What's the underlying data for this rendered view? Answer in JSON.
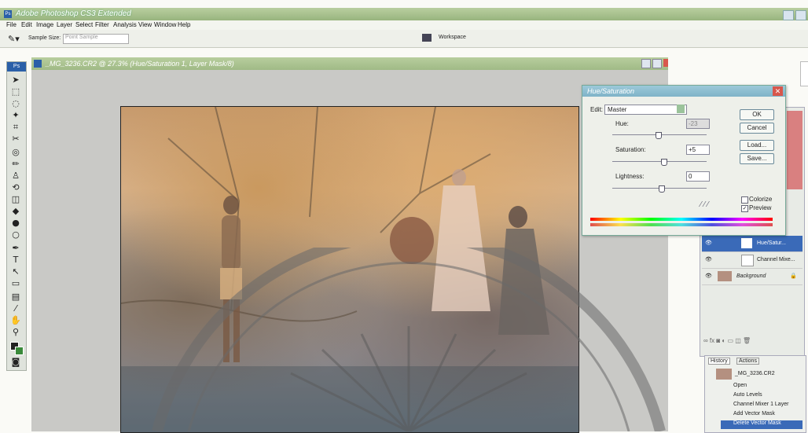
{
  "app": {
    "title": "Adobe Photoshop CS3 Extended",
    "logo": "Ps",
    "window_buttons": [
      "minimize",
      "close"
    ]
  },
  "menu": [
    "File",
    "Edit",
    "Image",
    "Layer",
    "Select",
    "Filter",
    "Analysis",
    "View",
    "Window",
    "Help"
  ],
  "options_bar": {
    "sample_size_label": "Sample Size:",
    "sample_size_value": "Point Sample",
    "workspace_label": "Workspace"
  },
  "document": {
    "title": "_MG_3236.CR2 @ 27.3% (Hue/Saturation 1, Layer Mask/8)"
  },
  "dialog": {
    "title": "Hue/Saturation",
    "edit_label": "Edit:",
    "edit_value": "Master",
    "hue_label": "Hue:",
    "hue_value": "-23",
    "saturation_label": "Saturation:",
    "saturation_value": "+5",
    "lightness_label": "Lightness:",
    "lightness_value": "0",
    "ok": "OK",
    "cancel": "Cancel",
    "load": "Load...",
    "save": "Save...",
    "colorize": "Colorize",
    "preview": "Preview",
    "preview_checked": true
  },
  "layers": [
    {
      "name": "Hue/Satur..."
    },
    {
      "name": "Channel Mixe..."
    },
    {
      "name": "Background"
    }
  ],
  "history": {
    "tabs": [
      "History",
      "Actions"
    ],
    "snapshot": "_MG_3236.CR2",
    "items": [
      "Open",
      "Auto Levels",
      "Channel Mixer 1 Layer",
      "Add Vector Mask",
      "Delete Vector Mask"
    ]
  },
  "colors": {
    "title_green": "#98b47e",
    "dialog_blue": "#7fb3c8",
    "close_red": "#d8574c"
  }
}
